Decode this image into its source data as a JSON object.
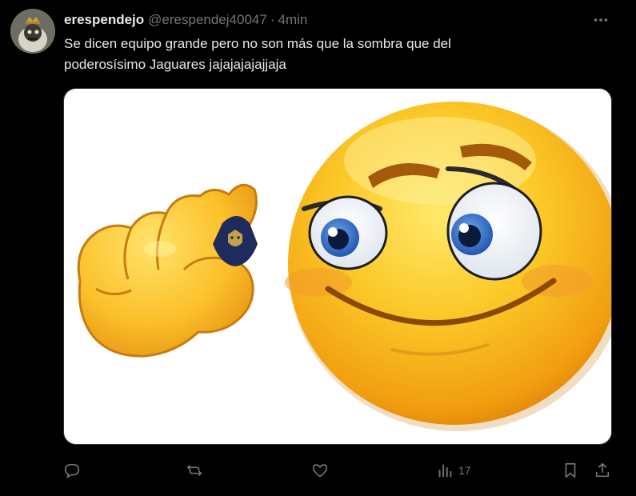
{
  "author": {
    "display_name": "erespendejo",
    "handle": "@erespendej40047",
    "separator": "·",
    "time": "4min"
  },
  "tweet": {
    "text_line1": "Se dicen equipo grande pero no son más que la sombra que del",
    "text_line2": "poderosísimo Jaguares jajajajajajjaja"
  },
  "media": {
    "description_icon": "emoji-small-gesture-with-pumas-crest"
  },
  "actions": {
    "reply_icon": "reply-icon",
    "retweet_icon": "retweet-icon",
    "like_icon": "heart-icon",
    "views_icon": "views-bar-chart-icon",
    "views_count": "17",
    "bookmark_icon": "bookmark-icon",
    "share_icon": "share-icon"
  },
  "colors": {
    "background": "#000000",
    "text_primary": "#e7e9ea",
    "text_secondary": "#71767b",
    "emoji_yellow": "#f6b418",
    "crest_navy": "#1f2b5c",
    "crest_gold": "#c6a14a"
  }
}
